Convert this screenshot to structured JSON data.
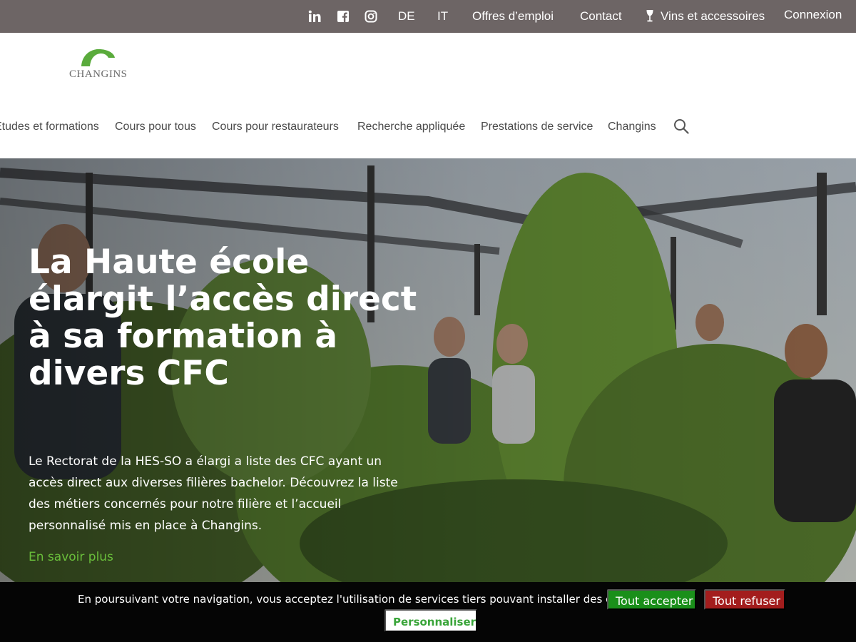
{
  "topbar": {
    "social_icons": [
      "linkedin-icon",
      "facebook-icon",
      "instagram-icon"
    ],
    "lang_de": "DE",
    "lang_it": "IT",
    "jobs": "Offres d’emploi",
    "contact": "Contact",
    "wines": "Vins et accessoires",
    "wines_icon": "wine-glass-icon",
    "login": "Connexion"
  },
  "header": {
    "logo_text": "CHANGINS",
    "logo_color": "#5aab3c",
    "search_icon": "search-icon",
    "nav": [
      {
        "label": "Études et formations"
      },
      {
        "label": "Cours pour tous"
      },
      {
        "label": "Cours pour restaurateurs"
      },
      {
        "label": "Recherche appliquée"
      },
      {
        "label": "Prestations de service"
      },
      {
        "label": "Changins"
      }
    ]
  },
  "hero": {
    "title": "La Haute école élargit l’accès direct à sa formation à divers CFC",
    "text": "Le Rectorat de la HES-SO a élargi a liste des CFC ayant un accès direct aux diverses filières bachelor. Découvrez la liste des métiers concernés pour notre filière et l’accueil personnalisé mis en place à Changins.",
    "link": "En savoir plus",
    "link_color": "#6abf3b"
  },
  "cookie": {
    "text": "En poursuivant votre navigation, vous acceptez l'utilisation de services tiers pouvant installer des cookies",
    "accept": "Tout accepter",
    "refuse": "Tout refuser",
    "customize": "Personnaliser",
    "accept_color": "#1a8f1a",
    "refuse_color": "#a31d1d"
  },
  "colors": {
    "topbar_bg": "#6d6565",
    "nav_text": "#4a4a4a"
  }
}
